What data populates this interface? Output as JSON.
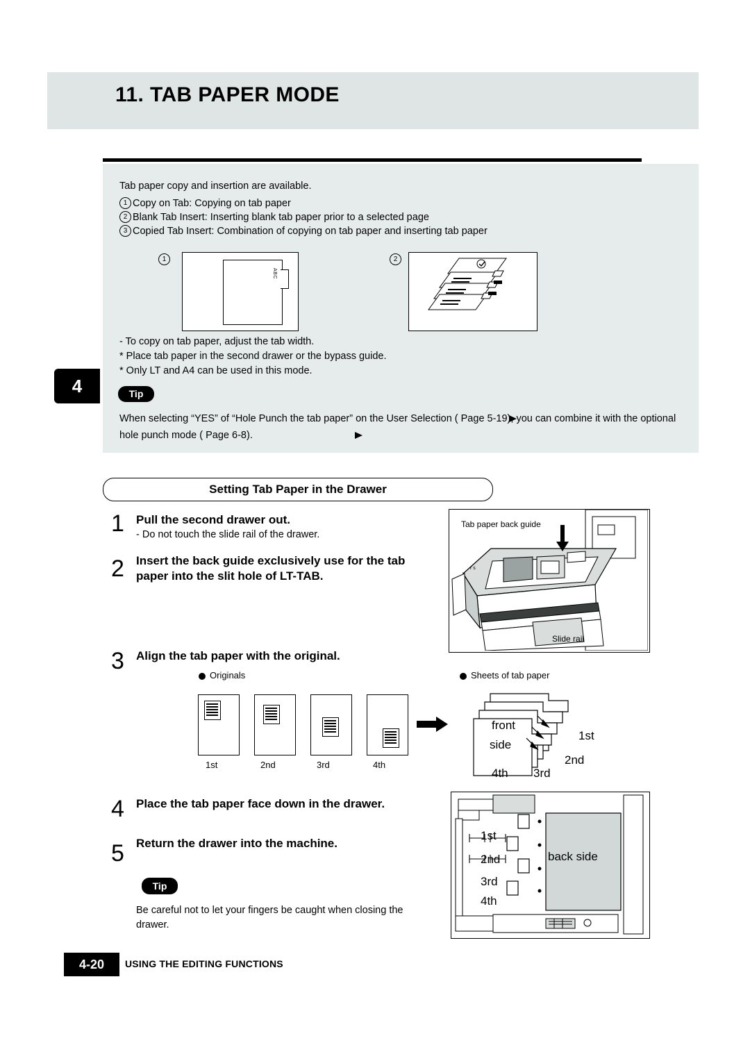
{
  "header": {
    "title": "11. TAB PAPER MODE"
  },
  "intro": {
    "line1": "Tab paper copy and insertion are available.",
    "item1": "Copy on Tab: Copying on tab paper",
    "item2": "Blank Tab Insert: Inserting blank tab paper prior to a selected page",
    "item3": "Copied Tab Insert: Combination of copying on tab paper and inserting tab paper",
    "num1": "1",
    "num2": "2",
    "num3": "3",
    "fig_num1": "1",
    "fig_num2": "2",
    "fig_tab_text": "ABC",
    "note1": "-  To copy on tab paper, adjust the tab width.",
    "note2": "*   Place tab paper in the second drawer or the bypass guide.",
    "note3": "*   Only LT and A4 can be used in this mode.",
    "tip_label": "Tip",
    "tip_body": "When selecting “YES” of “Hole Punch the tab paper” on the User Selection (    Page 5-19), you can combine it with the optional hole punch mode (    Page 6-8)."
  },
  "chapter_tab": "4",
  "section": {
    "title": "Setting Tab Paper in the Drawer"
  },
  "steps": [
    {
      "num": "1",
      "title": "Pull the second drawer out.",
      "sub": "-  Do not touch the slide rail of the drawer."
    },
    {
      "num": "2",
      "title_line1": "Insert the back guide exclusively use for the tab",
      "title_line2": "paper into the slit hole of LT-TAB."
    },
    {
      "num": "3",
      "title": "Align the tab paper with the original."
    },
    {
      "num": "4",
      "title": "Place the tab paper face down in the drawer."
    },
    {
      "num": "5",
      "title": "Return the drawer into the machine."
    }
  ],
  "drawer_figure": {
    "back_guide_label": "Tab paper back guide",
    "slide_rail_label": "Slide rail"
  },
  "align_figure": {
    "originals_label": "Originals",
    "sheets_label": "Sheets of tab paper",
    "orig_order": [
      "1st",
      "2nd",
      "3rd",
      "4th"
    ],
    "front": "front",
    "side": "side",
    "tabs": [
      "1st",
      "2nd",
      "3rd",
      "4th"
    ]
  },
  "drawer_detail": {
    "rows": [
      "1st",
      "2nd",
      "3rd",
      "4th"
    ],
    "back_side": "back side"
  },
  "tip2": {
    "label": "Tip",
    "body_line1": "Be careful not to let your fingers be caught when closing the",
    "body_line2": "drawer."
  },
  "footer": {
    "page": "4-20",
    "text": "USING THE EDITING FUNCTIONS"
  }
}
